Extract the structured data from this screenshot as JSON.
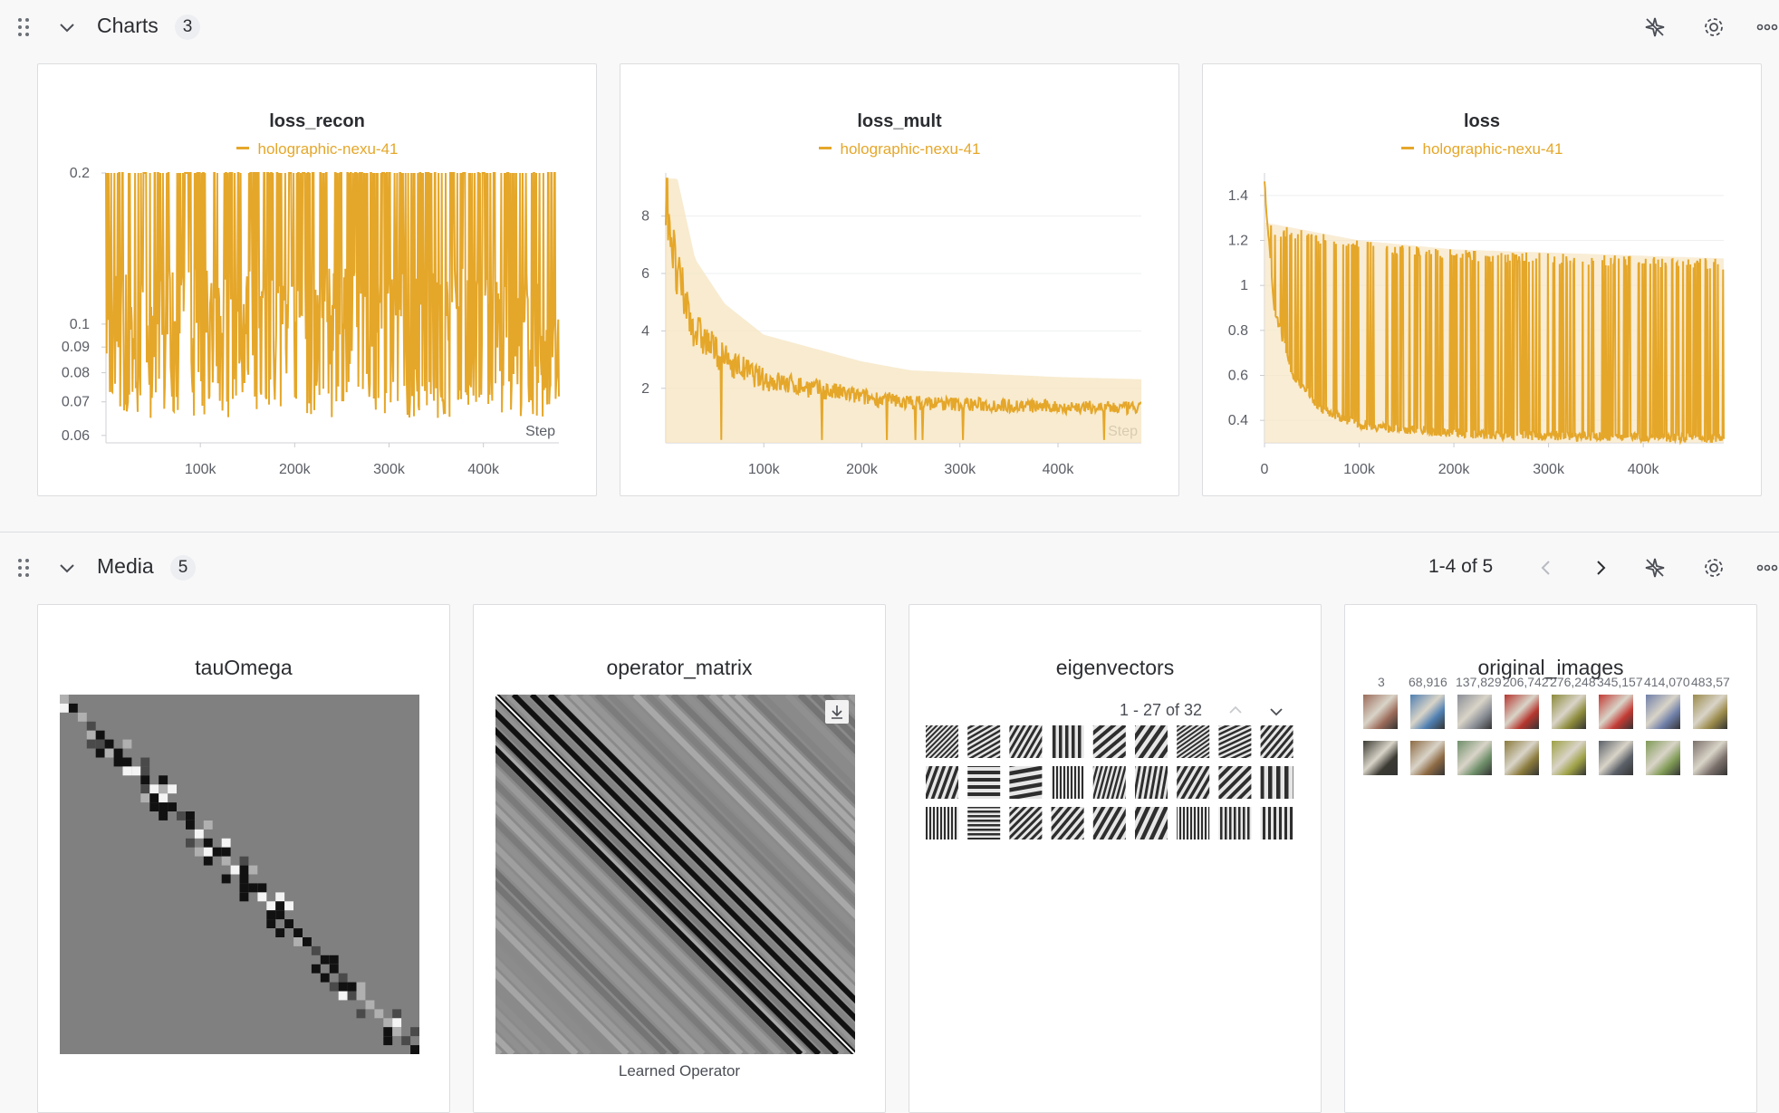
{
  "colors": {
    "accent": "#e5a72a",
    "band": "#f6e6c3"
  },
  "charts_section": {
    "title": "Charts",
    "count": "3",
    "icons": [
      "drag-handle-icon",
      "chevron-down-icon",
      "sparkle-pin-icon",
      "gear-icon",
      "more-icon"
    ]
  },
  "chart_data": [
    {
      "type": "line",
      "title": "loss_recon",
      "series": [
        {
          "name": "holographic-nexu-41"
        }
      ],
      "x_ticks": [
        "100k",
        "200k",
        "300k",
        "400k"
      ],
      "y_ticks": [
        "0.2",
        "0.1",
        "0.09",
        "0.08",
        "0.07",
        "0.06"
      ],
      "xlabel": "Step",
      "x_range": [
        0,
        480000
      ],
      "y_range": [
        0.058,
        0.2
      ],
      "y_scale": "log",
      "approx_band": [
        0.065,
        0.2
      ],
      "grid": false
    },
    {
      "type": "line",
      "title": "loss_mult",
      "series": [
        {
          "name": "holographic-nexu-41"
        }
      ],
      "x_ticks": [
        "100k",
        "200k",
        "300k",
        "400k"
      ],
      "y_ticks": [
        "8",
        "6",
        "4",
        "2"
      ],
      "xlabel": "Step",
      "x_range": [
        0,
        485000
      ],
      "y_range": [
        0.1,
        9.5
      ],
      "approx_points": [
        [
          0,
          9.3
        ],
        [
          10000,
          6
        ],
        [
          30000,
          4
        ],
        [
          60000,
          3
        ],
        [
          100000,
          2.3
        ],
        [
          150000,
          2
        ],
        [
          200000,
          1.7
        ],
        [
          250000,
          1.5
        ],
        [
          300000,
          1.45
        ],
        [
          400000,
          1.35
        ],
        [
          485000,
          1.3
        ]
      ],
      "grid": true
    },
    {
      "type": "line",
      "title": "loss",
      "series": [
        {
          "name": "holographic-nexu-41"
        }
      ],
      "x_ticks": [
        "0",
        "100k",
        "200k",
        "300k",
        "400k"
      ],
      "y_ticks": [
        "1.4",
        "1.2",
        "1",
        "0.8",
        "0.6",
        "0.4"
      ],
      "xlabel": "",
      "x_range": [
        0,
        485000
      ],
      "y_range": [
        0.3,
        1.5
      ],
      "approx_points": [
        [
          0,
          1.45
        ],
        [
          10000,
          0.9
        ],
        [
          30000,
          0.6
        ],
        [
          60000,
          0.45
        ],
        [
          100000,
          0.38
        ],
        [
          200000,
          0.34
        ],
        [
          300000,
          0.33
        ],
        [
          485000,
          0.32
        ]
      ],
      "upper_envelope": [
        [
          0,
          1.28
        ],
        [
          100000,
          1.2
        ],
        [
          200000,
          1.16
        ],
        [
          485000,
          1.12
        ]
      ],
      "grid": true
    }
  ],
  "media_section": {
    "title": "Media",
    "count": "5",
    "pager": "1-4 of 5",
    "icons": [
      "chevron-left-icon",
      "chevron-right-icon",
      "sparkle-pin-icon",
      "gear-icon",
      "more-icon"
    ]
  },
  "media": {
    "tau": {
      "title": "tauOmega"
    },
    "operator": {
      "title": "operator_matrix",
      "caption": "Learned Operator"
    },
    "eigen": {
      "title": "eigenvectors",
      "pager": "1 - 27 of 32"
    },
    "original": {
      "title": "original_images",
      "labels": [
        "3",
        "68,916",
        "137,829",
        "206,742",
        "276,248",
        "345,157",
        "414,070",
        "483,57"
      ],
      "palette": [
        "#9b6b5a",
        "#4f7fb1",
        "#8a8e96",
        "#b5372f",
        "#8c8a3a",
        "#c23a34",
        "#6f7fa8",
        "#9a8a4a",
        "#3b3a33",
        "#8d6a44",
        "#6f8f6a",
        "#8a7a3c",
        "#9ea145",
        "#5b6068",
        "#7f9a55",
        "#7a6f6a"
      ]
    }
  }
}
